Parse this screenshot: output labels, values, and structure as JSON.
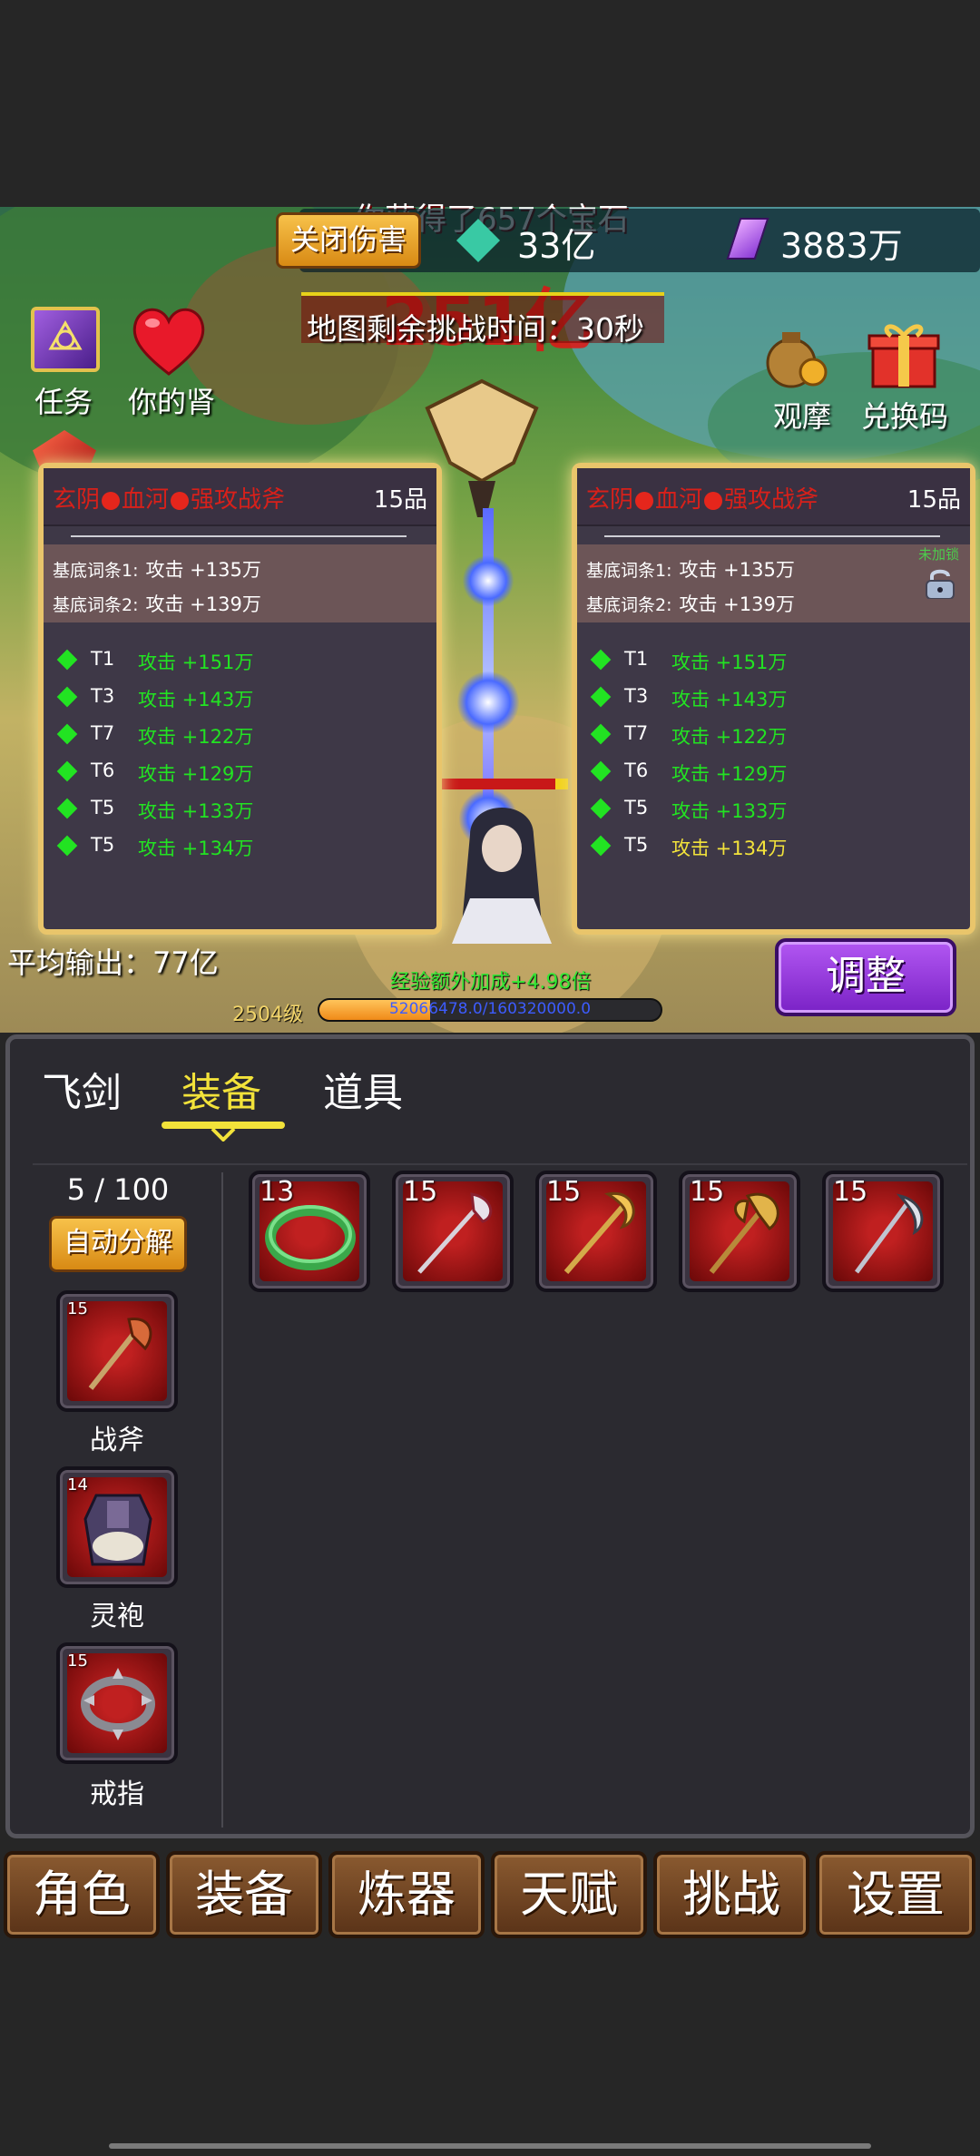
{
  "hud": {
    "close_damage": "关闭伤害",
    "top_banner": "你获得了657个宝石",
    "currency1": "33亿",
    "currency2": "3883万",
    "map_time": "地图剩余挑战时间：30秒",
    "dmg_big": "251亿",
    "task": "任务",
    "kidney": "你的肾",
    "watch": "观摩",
    "redeem": "兑换码",
    "avg_output": "平均输出：77亿",
    "adjust": "调整",
    "exp_bonus": "经验额外加成+4.98倍",
    "level": "2504级",
    "exp_text": "52066478.0/160320000.0",
    "exp_progress": 0.325
  },
  "left_card": {
    "name_parts": [
      "玄阴",
      "血河",
      "强攻战斧"
    ],
    "grade": "15品",
    "base": [
      {
        "label": "基底词条1:",
        "value": "攻击 +135万"
      },
      {
        "label": "基底词条2:",
        "value": "攻击 +139万"
      }
    ],
    "affixes": [
      {
        "tier": "T1",
        "value": "攻击 +151万"
      },
      {
        "tier": "T3",
        "value": "攻击 +143万"
      },
      {
        "tier": "T7",
        "value": "攻击 +122万"
      },
      {
        "tier": "T6",
        "value": "攻击 +129万"
      },
      {
        "tier": "T5",
        "value": "攻击 +133万"
      },
      {
        "tier": "T5",
        "value": "攻击 +134万"
      }
    ]
  },
  "right_card": {
    "name_parts": [
      "玄阴",
      "血河",
      "强攻战斧"
    ],
    "grade": "15品",
    "lock_label": "未加锁",
    "base": [
      {
        "label": "基底词条1:",
        "value": "攻击 +135万"
      },
      {
        "label": "基底词条2:",
        "value": "攻击 +139万"
      }
    ],
    "affixes": [
      {
        "tier": "T1",
        "value": "攻击 +151万"
      },
      {
        "tier": "T3",
        "value": "攻击 +143万"
      },
      {
        "tier": "T7",
        "value": "攻击 +122万"
      },
      {
        "tier": "T6",
        "value": "攻击 +129万"
      },
      {
        "tier": "T5",
        "value": "攻击 +133万"
      },
      {
        "tier": "T5",
        "value": "攻击 +134万"
      }
    ]
  },
  "tabs": {
    "sword": "飞剑",
    "equip": "装备",
    "items": "道具"
  },
  "bag": {
    "count": "5 / 100",
    "auto_decompose": "自动分解"
  },
  "equipped": [
    {
      "level": "15",
      "name": "战斧"
    },
    {
      "level": "14",
      "name": "灵袍"
    },
    {
      "level": "15",
      "name": "戒指"
    }
  ],
  "inventory": [
    {
      "level": "13",
      "icon": "jade-ring-icon"
    },
    {
      "level": "15",
      "icon": "red-halberd-icon"
    },
    {
      "level": "15",
      "icon": "gold-axe-icon"
    },
    {
      "level": "15",
      "icon": "gold-battle-axe-icon"
    },
    {
      "level": "15",
      "icon": "silver-scythe-icon"
    }
  ],
  "nav": [
    "角色",
    "装备",
    "炼器",
    "天赋",
    "挑战",
    "设置"
  ],
  "colors": {
    "card_border": "#e9c56b",
    "equip_tab_active": "#f2e23a",
    "affix_green": "#22e322",
    "affix_yellow": "#f3e33b",
    "name_red": "#d8201a",
    "adjust_purple": "#8e2fd6"
  }
}
